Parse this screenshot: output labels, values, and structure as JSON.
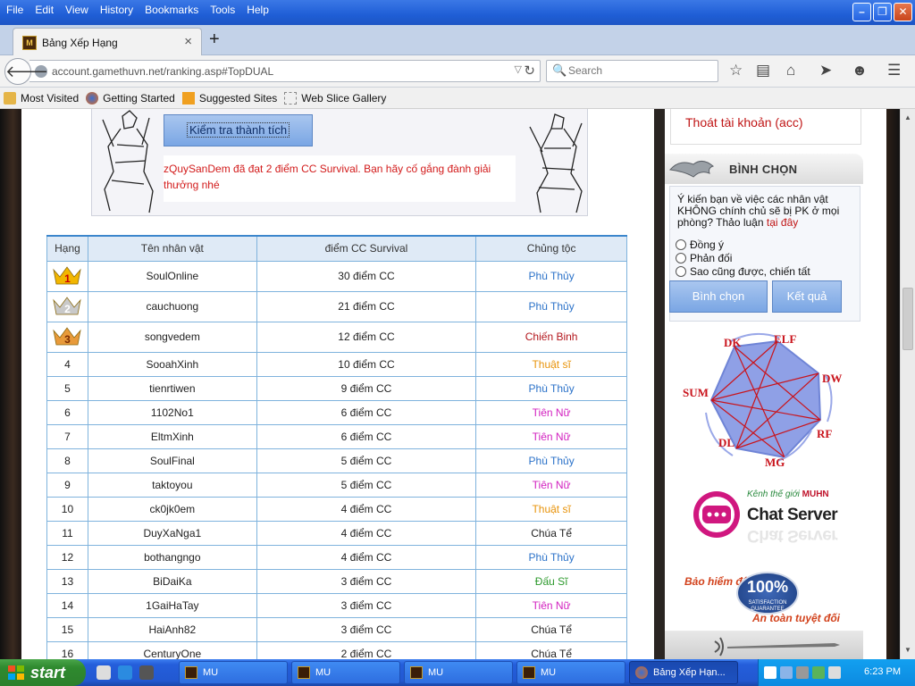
{
  "menu": [
    "File",
    "Edit",
    "View",
    "History",
    "Bookmarks",
    "Tools",
    "Help"
  ],
  "tab": {
    "title": "Bảng Xếp Hạng",
    "close": "×",
    "new_tab": "+"
  },
  "nav": {
    "url": "account.gamethuvn.net/ranking.asp#TopDUAL",
    "search_placeholder": "Search"
  },
  "bookmarks": [
    {
      "label": "Most Visited",
      "icon": "folder-icon",
      "color": "#e5b548"
    },
    {
      "label": "Getting Started",
      "icon": "firefox-icon",
      "color": "#e06a1b"
    },
    {
      "label": "Suggested Sites",
      "icon": "suggested-sites-icon",
      "color": "#f0a020"
    },
    {
      "label": "Web Slice Gallery",
      "icon": "web-slice-icon",
      "color": "#cccccc"
    }
  ],
  "achievement": {
    "button": "Kiểm tra thành tích",
    "message": "zQuySanDem đã đạt 2 điểm CC Survival. Bạn hãy cố gắng đành giải thưởng nhé"
  },
  "table": {
    "headers": [
      "Hạng",
      "Tên nhân vật",
      "điểm CC Survival",
      "Chủng tộc"
    ],
    "rows": [
      {
        "rank": "1",
        "name": "SoulOnline",
        "score": "30 điểm CC",
        "race": "Phù Thủy",
        "race_color": "#2b72c9"
      },
      {
        "rank": "2",
        "name": "cauchuong",
        "score": "21 điểm CC",
        "race": "Phù Thủy",
        "race_color": "#2b72c9"
      },
      {
        "rank": "3",
        "name": "songvedem",
        "score": "12 điểm CC",
        "race": "Chiến Binh",
        "race_color": "#b3161c"
      },
      {
        "rank": "4",
        "name": "SooahXinh",
        "score": "10 điểm CC",
        "race": "Thuật sĩ",
        "race_color": "#e8930a"
      },
      {
        "rank": "5",
        "name": "tienrtiwen",
        "score": "9 điểm CC",
        "race": "Phù Thủy",
        "race_color": "#2b72c9"
      },
      {
        "rank": "6",
        "name": "1102No1",
        "score": "6 điểm CC",
        "race": "Tiên Nữ",
        "race_color": "#d21fbf"
      },
      {
        "rank": "7",
        "name": "EltmXinh",
        "score": "6 điểm CC",
        "race": "Tiên Nữ",
        "race_color": "#d21fbf"
      },
      {
        "rank": "8",
        "name": "SoulFinal",
        "score": "5 điểm CC",
        "race": "Phù Thủy",
        "race_color": "#2b72c9"
      },
      {
        "rank": "9",
        "name": "taktoyou",
        "score": "5 điểm CC",
        "race": "Tiên Nữ",
        "race_color": "#d21fbf"
      },
      {
        "rank": "10",
        "name": "ck0jk0em",
        "score": "4 điểm CC",
        "race": "Thuật sĩ",
        "race_color": "#e8930a"
      },
      {
        "rank": "11",
        "name": "DuyXaNga1",
        "score": "4 điểm CC",
        "race": "Chúa Tể",
        "race_color": "#222222"
      },
      {
        "rank": "12",
        "name": "bothangngo",
        "score": "4 điểm CC",
        "race": "Phù Thủy",
        "race_color": "#2b72c9"
      },
      {
        "rank": "13",
        "name": "BiDaiKa",
        "score": "3 điểm CC",
        "race": "Đấu Sĩ",
        "race_color": "#2e9a2e"
      },
      {
        "rank": "14",
        "name": "1GaiHaTay",
        "score": "3 điểm CC",
        "race": "Tiên Nữ",
        "race_color": "#d21fbf"
      },
      {
        "rank": "15",
        "name": "HaiAnh82",
        "score": "3 điểm CC",
        "race": "Chúa Tể",
        "race_color": "#222222"
      },
      {
        "rank": "16",
        "name": "CenturyOne",
        "score": "2 điểm CC",
        "race": "Chúa Tể",
        "race_color": "#222222"
      }
    ]
  },
  "sidebar": {
    "logout": "Thoát tài khoản (acc)",
    "vote_title": "BÌNH CHỌN",
    "vote_question": "Ý kiến bạn về việc các nhân vật KHÔNG chính chủ sẽ bị PK ở mọi phòng? Thảo luận",
    "vote_link": "tại đây",
    "options": [
      "Đồng ý",
      "Phản đối",
      "Sao cũng được, chiến tất"
    ],
    "vote_button": "Bình chọn",
    "result_button": "Kết quả",
    "classes": [
      "DK",
      "ELF",
      "DW",
      "RF",
      "MG",
      "DL",
      "SUM"
    ],
    "chat_top": "Kênh thế giới",
    "chat_brand": "MUHN",
    "chat_title": "Chat Server",
    "insurance_title": "Bảo hiểm độ",
    "insurance_pct": "100%",
    "insurance_badge": "SATISFACTION GUARANTEE",
    "insurance_sub": "An toàn tuyệt đối"
  },
  "taskbar": {
    "start": "start",
    "tasks": [
      "MU",
      "MU",
      "MU",
      "MU",
      "Bảng Xếp Hạn..."
    ],
    "clock": "6:23 PM"
  }
}
